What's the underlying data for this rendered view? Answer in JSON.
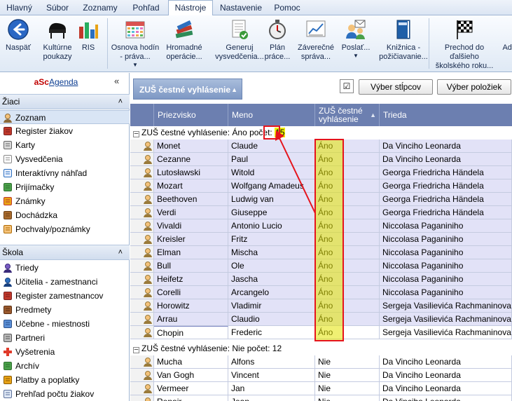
{
  "tabs": [
    "Hlavný",
    "Súbor",
    "Zoznamy",
    "Pohľad",
    "Nástroje",
    "Nastavenie",
    "Pomoc"
  ],
  "active_tab": "Nástroje",
  "ribbon": [
    {
      "label": "Naspäť",
      "icon": "back-arrow-icon"
    },
    {
      "label": "Kultúrne\npoukazy",
      "icon": "piano-icon"
    },
    {
      "label": "RIS",
      "icon": "bar-chart-icon"
    },
    {
      "label": "Osnova hodín\n- práva...",
      "icon": "calendar-icon",
      "dropdown": true
    },
    {
      "label": "Hromadné\noperácie...",
      "icon": "books-stack-icon"
    },
    {
      "label": "Generuj\nvysvedčenia...",
      "icon": "certificate-icon"
    },
    {
      "label": "Plán\npráce...",
      "icon": "stopwatch-icon"
    },
    {
      "label": "Záverečné\nspráva...",
      "icon": "report-chart-icon"
    },
    {
      "label": "Poslať...",
      "icon": "send-users-icon",
      "dropdown": true
    },
    {
      "label": "Knižnica -\npožičiavanie...",
      "icon": "book-icon"
    },
    {
      "label": "Prechod do\nďalšieho\nškolského roku...",
      "icon": "checkered-flag-icon"
    },
    {
      "label": "Adr",
      "icon": ""
    }
  ],
  "sidebar": {
    "logo_a": "aSc",
    "logo_b": "Agenda",
    "collapse_glyph": "«",
    "sections": [
      {
        "title": "Žiaci",
        "chevron": "˄",
        "items": [
          {
            "label": "Zoznam",
            "icon": "student-list-icon",
            "selected": true
          },
          {
            "label": "Register žiakov",
            "icon": "register-icon"
          },
          {
            "label": "Karty",
            "icon": "cards-icon"
          },
          {
            "label": "Vysvedčenia",
            "icon": "certificate-icon"
          },
          {
            "label": "Interaktívny náhľad",
            "icon": "interactive-preview-icon"
          },
          {
            "label": "Prijímačky",
            "icon": "admissions-icon"
          },
          {
            "label": "Známky",
            "icon": "grades-icon"
          },
          {
            "label": "Dochádzka",
            "icon": "attendance-icon"
          },
          {
            "label": "Pochvaly/poznámky",
            "icon": "praise-icon"
          }
        ]
      },
      {
        "title": "Škola",
        "chevron": "˄",
        "items": [
          {
            "label": "Triedy",
            "icon": "classes-icon"
          },
          {
            "label": "Učitelia - zamestnanci",
            "icon": "teachers-icon"
          },
          {
            "label": "Register zamestnancov",
            "icon": "staff-register-icon"
          },
          {
            "label": "Predmety",
            "icon": "subjects-icon"
          },
          {
            "label": "Učebne - miestnosti",
            "icon": "rooms-icon"
          },
          {
            "label": "Partneri",
            "icon": "partners-icon"
          },
          {
            "label": "Vyšetrenia",
            "icon": "medical-cross-icon"
          },
          {
            "label": "Archív",
            "icon": "archive-icon"
          },
          {
            "label": "Platby a poplatky",
            "icon": "payments-icon"
          },
          {
            "label": "Prehľad počtu žiakov",
            "icon": "student-count-icon"
          }
        ]
      }
    ]
  },
  "toolbar": {
    "group_label": "ZUŠ čestné vyhlásenie",
    "checkbox_glyph": "☑",
    "select_columns": "Výber stĺpcov",
    "select_items": "Výber položiek"
  },
  "columns": [
    "Priezvisko",
    "Meno",
    "ZUŠ čestné vyhlásenie",
    "Trieda"
  ],
  "sort_arrow": "▲",
  "groups": [
    {
      "label": "ZUŠ čestné vyhlásenie: Áno počet: ",
      "count": "15",
      "rows": [
        {
          "surname": "Monet",
          "name": "Claude",
          "zus": "Áno",
          "class": "Da Vinciho Leonarda"
        },
        {
          "surname": "Cezanne",
          "name": "Paul",
          "zus": "Áno",
          "class": "Da Vinciho Leonarda"
        },
        {
          "surname": "Lutosławski",
          "name": "Witold",
          "zus": "Áno",
          "class": "Georga Friedricha Händela"
        },
        {
          "surname": "Mozart",
          "name": "Wolfgang Amadeus",
          "zus": "Áno",
          "class": "Georga Friedricha Händela"
        },
        {
          "surname": "Beethoven",
          "name": "Ludwig van",
          "zus": "Áno",
          "class": "Georga Friedricha Händela"
        },
        {
          "surname": "Verdi",
          "name": "Giuseppe",
          "zus": "Áno",
          "class": "Georga Friedricha Händela"
        },
        {
          "surname": "Vivaldi",
          "name": "Antonio Lucio",
          "zus": "Áno",
          "class": "Niccolasa Paganiniho"
        },
        {
          "surname": "Kreisler",
          "name": "Fritz",
          "zus": "Áno",
          "class": "Niccolasa Paganiniho"
        },
        {
          "surname": "Elman",
          "name": "Mischa",
          "zus": "Áno",
          "class": "Niccolasa Paganiniho"
        },
        {
          "surname": "Bull",
          "name": "Ole",
          "zus": "Áno",
          "class": "Niccolasa Paganiniho"
        },
        {
          "surname": "Heifetz",
          "name": "Jascha",
          "zus": "Áno",
          "class": "Niccolasa Paganiniho"
        },
        {
          "surname": "Corelli",
          "name": "Arcangelo",
          "zus": "Áno",
          "class": "Niccolasa Paganiniho"
        },
        {
          "surname": "Horowitz",
          "name": "Vladimir",
          "zus": "Áno",
          "class": "Sergeja Vasilievića Rachmaninova"
        },
        {
          "surname": "Arrau",
          "name": "Claudio",
          "zus": "Áno",
          "class": "Sergeja Vasilievića Rachmaninova"
        },
        {
          "surname": "Chopin",
          "name": "Frederic",
          "zus": "Áno",
          "class": "Sergeja Vasilievića Rachmaninova",
          "selected": true
        }
      ]
    },
    {
      "label": "ZUŠ čestné vyhlásenie: Nie počet: ",
      "count": "12",
      "rows": [
        {
          "surname": "Mucha",
          "name": "Alfons",
          "zus": "Nie",
          "class": "Da Vinciho Leonarda"
        },
        {
          "surname": "Van Gogh",
          "name": "Vincent",
          "zus": "Nie",
          "class": "Da Vinciho Leonarda"
        },
        {
          "surname": "Vermeer",
          "name": "Jan",
          "zus": "Nie",
          "class": "Da Vinciho Leonarda"
        },
        {
          "surname": "Renoir",
          "name": "Jean",
          "zus": "Nie",
          "class": "Da Vinciho Leonarda"
        }
      ]
    }
  ],
  "colors": {
    "highlight": "#e4e400",
    "annotation": "#e5141c",
    "header": "#6c7fb0",
    "row": "#e2e2f7"
  }
}
